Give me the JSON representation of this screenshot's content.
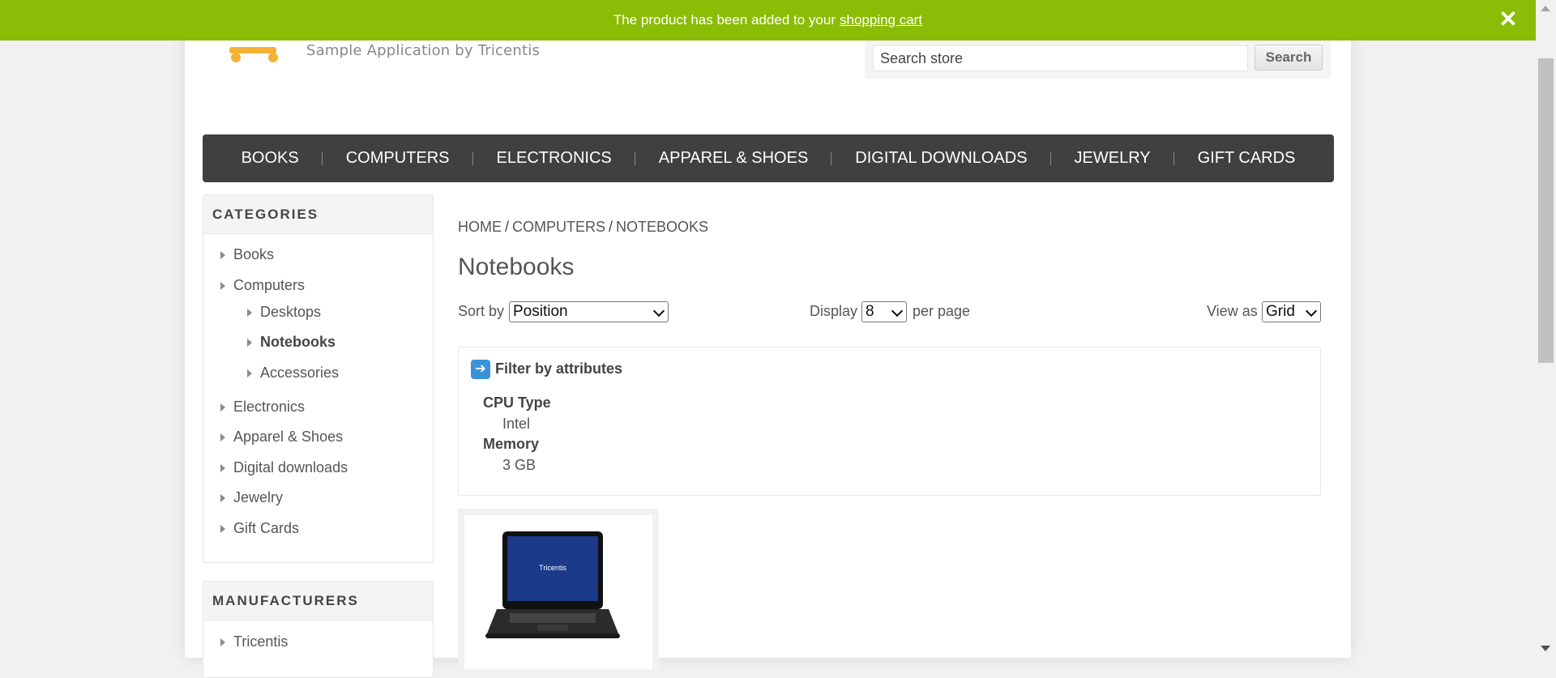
{
  "notification": {
    "text": "The product has been added to your",
    "link": "shopping cart",
    "close_icon": "close-icon"
  },
  "header": {
    "tagline": "Sample Application by Tricentis",
    "search_placeholder": "Search store",
    "search_button": "Search"
  },
  "top_menu": [
    "BOOKS",
    "COMPUTERS",
    "ELECTRONICS",
    "APPAREL & SHOES",
    "DIGITAL DOWNLOADS",
    "JEWELRY",
    "GIFT CARDS"
  ],
  "categories": {
    "title": "CATEGORIES",
    "items": [
      "Books",
      "Computers",
      "Desktops",
      "Notebooks",
      "Accessories",
      "Electronics",
      "Apparel & Shoes",
      "Digital downloads",
      "Jewelry",
      "Gift Cards"
    ],
    "active": "Notebooks"
  },
  "manufacturers": {
    "title": "MANUFACTURERS",
    "items": [
      "Tricentis"
    ]
  },
  "breadcrumb": [
    "HOME",
    "COMPUTERS",
    "NOTEBOOKS"
  ],
  "page_title": "Notebooks",
  "controls": {
    "sort_label": "Sort by",
    "sort_value": "Position",
    "display_label": "Display",
    "display_value": "8",
    "per_page_label": "per page",
    "view_label": "View as",
    "view_value": "Grid"
  },
  "filter": {
    "title": "Filter by attributes",
    "attributes": [
      {
        "name": "CPU Type",
        "value": "Intel"
      },
      {
        "name": "Memory",
        "value": "3 GB"
      }
    ]
  },
  "product": {
    "screen_brand": "Tricentis"
  },
  "colors": {
    "notification_green": "#8bbc06",
    "menu_dark": "#404040",
    "filter_icon_blue": "#3a93d8"
  }
}
